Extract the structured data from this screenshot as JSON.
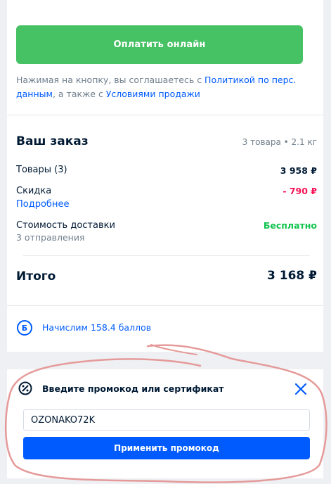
{
  "checkout": {
    "pay_button": "Оплатить онлайн",
    "consent_prefix": "Нажимая на кнопку, вы соглашаетесь с ",
    "consent_link_privacy": "Политикой по перс. данным",
    "consent_middle": ", а также с ",
    "consent_link_terms": "Условиями продажи"
  },
  "order": {
    "title": "Ваш заказ",
    "meta": "3 товара • 2.1 кг",
    "goods_label": "Товары (3)",
    "goods_value": "3 958 ₽",
    "discount_label": "Скидка",
    "discount_value": "- 790 ₽",
    "discount_details_link": "Подробнее",
    "delivery_label": "Стоимость доставки",
    "delivery_value": "Бесплатно",
    "delivery_sub": "3 отправления",
    "total_label": "Итого",
    "total_value": "3 168 ₽"
  },
  "bonus": {
    "icon_letter": "Б",
    "text": "Начислим 158.4 баллов"
  },
  "promo": {
    "title": "Введите промокод или сертификат",
    "input_value": "OZONAKO72K",
    "apply_button": "Применить промокод"
  },
  "colors": {
    "brand_blue": "#005bff",
    "pay_green": "#46c164",
    "discount_red": "#f91155",
    "free_green": "#10c44c",
    "annotation_pink": "#e59a99"
  },
  "icons": {
    "promo": "percent-badge-icon",
    "close": "close-icon",
    "bonus": "bonus-points-icon"
  }
}
